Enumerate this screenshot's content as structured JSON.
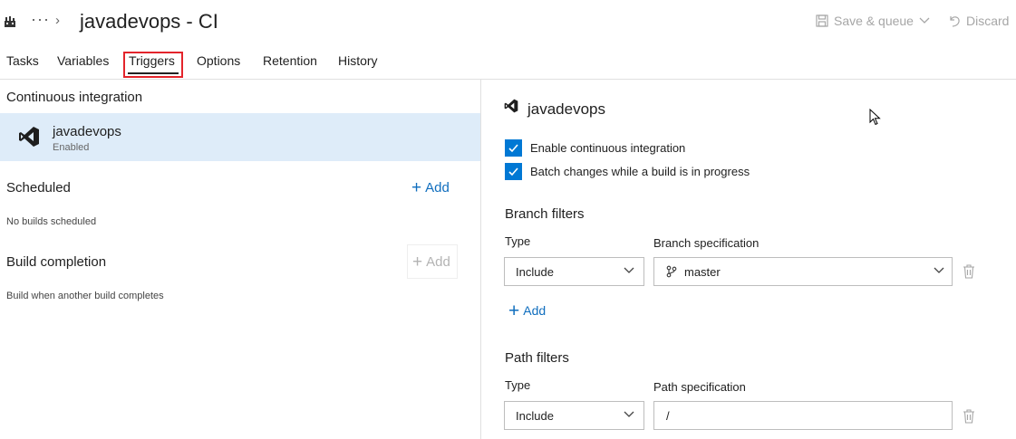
{
  "header": {
    "more": "···",
    "title": "javadevops - CI",
    "save_queue": "Save & queue",
    "discard": "Discard"
  },
  "tabs": [
    {
      "label": "Tasks"
    },
    {
      "label": "Variables"
    },
    {
      "label": "Triggers"
    },
    {
      "label": "Options"
    },
    {
      "label": "Retention"
    },
    {
      "label": "History"
    }
  ],
  "left": {
    "ci_title": "Continuous integration",
    "ci_item": {
      "name": "javadevops",
      "status": "Enabled"
    },
    "scheduled_title": "Scheduled",
    "scheduled_add": "Add",
    "scheduled_note": "No builds scheduled",
    "completion_title": "Build completion",
    "completion_add": "Add",
    "completion_note": "Build when another build completes"
  },
  "right": {
    "repo_name": "javadevops",
    "enable_ci": {
      "label": "Enable continuous integration",
      "checked": true
    },
    "batch_changes": {
      "label": "Batch changes while a build is in progress",
      "checked": true
    },
    "branch_filters": {
      "title": "Branch filters",
      "type_label": "Type",
      "spec_label": "Branch specification",
      "type_value": "Include",
      "spec_value": "master",
      "add_label": "Add"
    },
    "path_filters": {
      "title": "Path filters",
      "type_label": "Type",
      "spec_label": "Path specification",
      "type_value": "Include",
      "spec_value": "/"
    }
  },
  "colors": {
    "accent": "#0078d4",
    "link": "#106ebe",
    "selected_row": "#deecf9",
    "highlight_box": "#e3242b"
  }
}
